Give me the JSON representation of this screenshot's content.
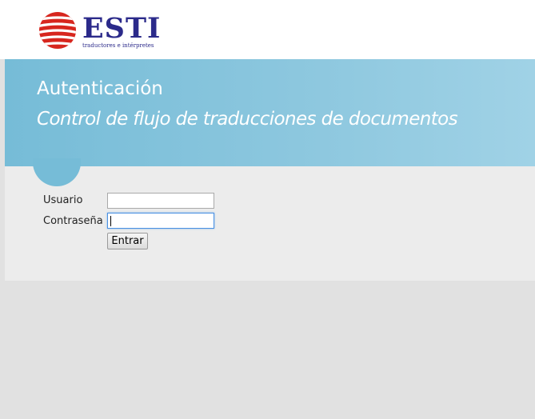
{
  "brand": {
    "name": "ESTI",
    "tagline": "traductores e intérpretes",
    "colors": {
      "logo_red": "#d7261e",
      "logo_blue": "#2b2a8a",
      "banner_blue": "#76bcd7"
    }
  },
  "banner": {
    "title": "Autenticación",
    "subtitle": "Control de flujo de traducciones de documentos"
  },
  "login_form": {
    "username_label": "Usuario",
    "username_value": "",
    "password_label": "Contraseña",
    "password_value": "",
    "submit_label": "Entrar"
  }
}
